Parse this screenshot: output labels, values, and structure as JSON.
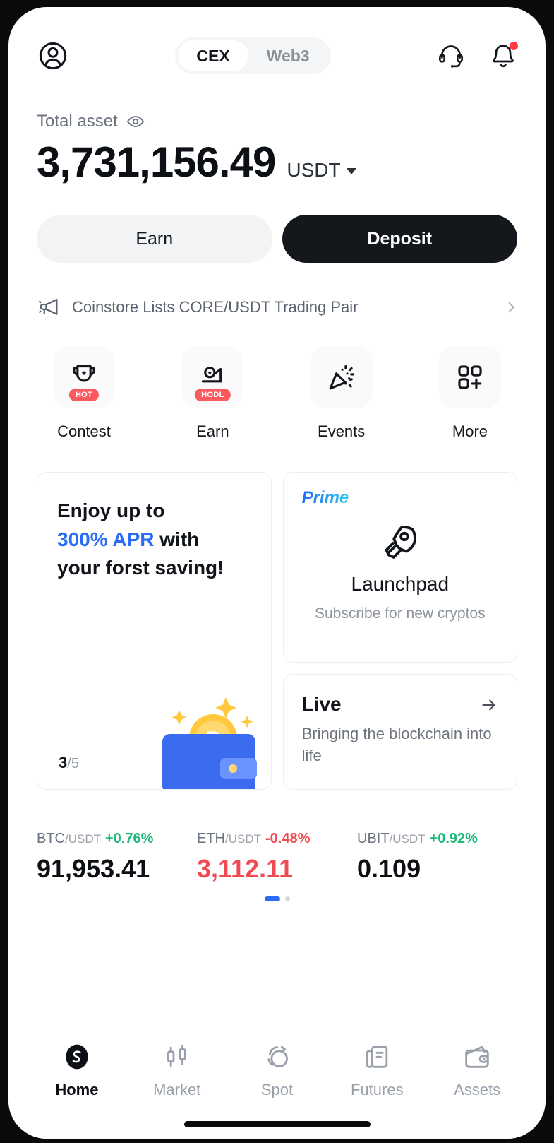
{
  "header": {
    "avatar_icon": "user-circle-icon",
    "tabs": [
      {
        "label": "CEX",
        "active": true
      },
      {
        "label": "Web3",
        "active": false
      }
    ],
    "support_icon": "headset-icon",
    "notification_icon": "bell-icon",
    "notification_badge": true
  },
  "balance": {
    "label": "Total asset",
    "visibility_icon": "eye-icon",
    "amount": "3,731,156.49",
    "currency": "USDT",
    "currency_caret_icon": "caret-down-icon"
  },
  "actions": {
    "earn_label": "Earn",
    "deposit_label": "Deposit"
  },
  "announcement": {
    "icon": "megaphone-icon",
    "text": "Coinstore Lists CORE/USDT Trading Pair",
    "chevron_icon": "chevron-right-icon"
  },
  "quick_actions": [
    {
      "label": "Contest",
      "icon": "trophy-icon",
      "badge": "HOT"
    },
    {
      "label": "Earn",
      "icon": "piggy-hand-icon",
      "badge": "HODL"
    },
    {
      "label": "Events",
      "icon": "party-popper-icon",
      "badge": ""
    },
    {
      "label": "More",
      "icon": "grid-plus-icon",
      "badge": ""
    }
  ],
  "promo_card": {
    "line1": "Enjoy up to",
    "highlight": "300% APR",
    "line2_after": " with",
    "line3": "your forst saving!",
    "counter_current": "3",
    "counter_total": "/5",
    "illustration": "wallet-bitcoin-icon"
  },
  "launchpad_card": {
    "tag": "Prime",
    "icon": "rocket-icon",
    "title": "Launchpad",
    "subtitle": "Subscribe for new cryptos"
  },
  "live_card": {
    "title": "Live",
    "arrow_icon": "arrow-right-icon",
    "subtitle": "Bringing the blockchain into life"
  },
  "tickers": [
    {
      "base": "BTC",
      "quote": "/USDT",
      "change": "+0.76%",
      "direction": "up",
      "price": "91,953.41",
      "price_direction": "neutral"
    },
    {
      "base": "ETH",
      "quote": "/USDT",
      "change": "-0.48%",
      "direction": "down",
      "price": "3,112.11",
      "price_direction": "down"
    },
    {
      "base": "UBIT",
      "quote": "/USDT",
      "change": "+0.92%",
      "direction": "up",
      "price": "0.109",
      "price_direction": "neutral"
    }
  ],
  "carousel": {
    "pages": 2,
    "active_index": 0
  },
  "bottom_nav": [
    {
      "label": "Home",
      "icon": "coinstore-logo-icon",
      "active": true
    },
    {
      "label": "Market",
      "icon": "candlestick-icon",
      "active": false
    },
    {
      "label": "Spot",
      "icon": "swap-circles-icon",
      "active": false
    },
    {
      "label": "Futures",
      "icon": "contract-doc-icon",
      "active": false
    },
    {
      "label": "Assets",
      "icon": "wallet-icon",
      "active": false
    }
  ],
  "colors": {
    "accent_blue": "#2a6cf5",
    "up_green": "#1fb978",
    "down_red": "#f04a52",
    "badge_red": "#fa5a5f",
    "dark": "#14171c"
  }
}
